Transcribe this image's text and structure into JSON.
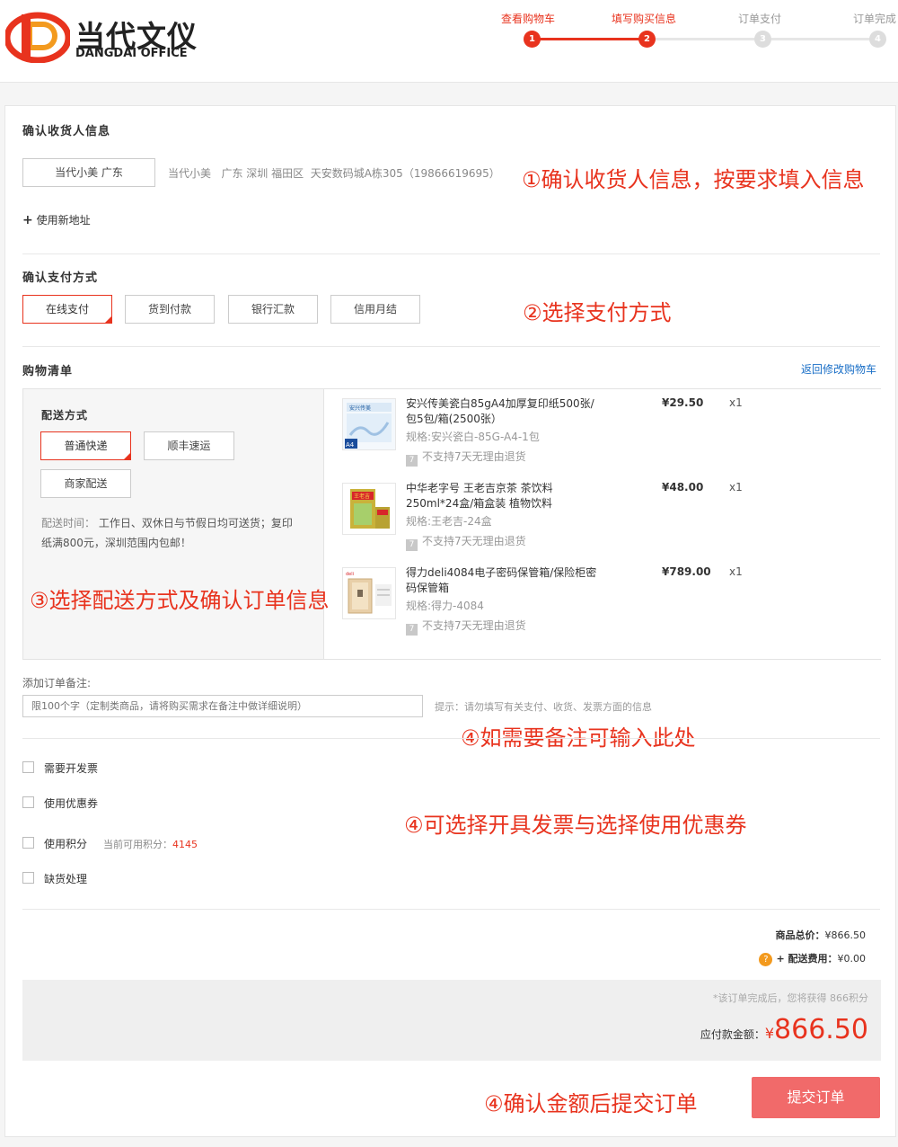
{
  "header": {
    "logo_cn": "当代文仪",
    "logo_en": "DANGDAI OFFICE",
    "steps": [
      {
        "label": "查看购物车",
        "num": "1"
      },
      {
        "label": "填写购买信息",
        "num": "2"
      },
      {
        "label": "订单支付",
        "num": "3"
      },
      {
        "label": "订单完成",
        "num": "4"
      }
    ],
    "current_step": 2
  },
  "consignee": {
    "title": "确认收货人信息",
    "selected_address_label": "当代小美 广东",
    "address_detail": "当代小美   广东 深圳 福田区  天安数码城A栋305（19866619695）",
    "add_address": "使用新地址",
    "annotation": "①确认收货人信息，按要求填入信息"
  },
  "payment": {
    "title": "确认支付方式",
    "options": [
      "在线支付",
      "货到付款",
      "银行汇款",
      "信用月结"
    ],
    "selected": "在线支付",
    "annotation": "②选择支付方式"
  },
  "cart": {
    "title": "购物清单",
    "back_link": "返回修改购物车",
    "shipping_title": "配送方式",
    "shipping_options": [
      "普通快递",
      "顺丰速运",
      "商家配送"
    ],
    "shipping_selected": "普通快递",
    "shipping_note_label": "配送时间：",
    "shipping_note_line1": "工作日、双休日与节假日均可送货；复印",
    "shipping_note_line2": "纸满800元，深圳范围内包邮！",
    "annotation": "③选择配送方式及确认订单信息",
    "items": [
      {
        "name": "安兴传美瓷白85gA4加厚复印纸500张/包5包/箱(2500张）",
        "spec": "规格:安兴瓷白-85G-A4-1包",
        "price": "¥29.50",
        "qty": "x1",
        "return_icon": "7",
        "return_text": "不支持7天无理由退货"
      },
      {
        "name": "中华老字号 王老吉京茶 茶饮料250ml*24盒/箱盒装 植物饮料",
        "spec": "规格:王老吉-24盒",
        "price": "¥48.00",
        "qty": "x1",
        "return_icon": "7",
        "return_text": "不支持7天无理由退货"
      },
      {
        "name": "得力deli4084电子密码保管箱/保险柜密码保管箱",
        "spec": "规格:得力-4084",
        "price": "¥789.00",
        "qty": "x1",
        "return_icon": "7",
        "return_text": "不支持7天无理由退货"
      }
    ],
    "thumb_text": {
      "paper_brand": "安兴传美",
      "paper_size": "A4",
      "tea_brand": "王老吉",
      "safe_brand": "deli"
    }
  },
  "remark": {
    "label": "添加订单备注:",
    "placeholder": "限100个字（定制类商品，请将购买需求在备注中做详细说明）",
    "tip": "提示：请勿填写有关支付、收货、发票方面的信息",
    "annotation": "④如需要备注可输入此处"
  },
  "options": {
    "invoice": "需要开发票",
    "coupon": "使用优惠券",
    "points": "使用积分",
    "points_available_label": "当前可用积分：",
    "points_available_value": "4145",
    "shortage": "缺货处理",
    "annotation": "④可选择开具发票与选择使用优惠券"
  },
  "summary": {
    "goods_total_label": "商品总价：",
    "goods_total": "¥866.50",
    "shipping_fee_label": "+ 配送费用：",
    "shipping_fee": "¥0.00",
    "help_icon": "?",
    "points_note": "*该订单完成后，您将获得 866积分",
    "payable_label": "应付款金额：",
    "payable_currency": "¥",
    "payable_amount": "866.50",
    "submit_label": "提交订单",
    "annotation": "④确认金额后提交订单"
  },
  "colors": {
    "accent": "#e8331e",
    "submit": "#f16a6a",
    "link": "#1a6fc7"
  }
}
